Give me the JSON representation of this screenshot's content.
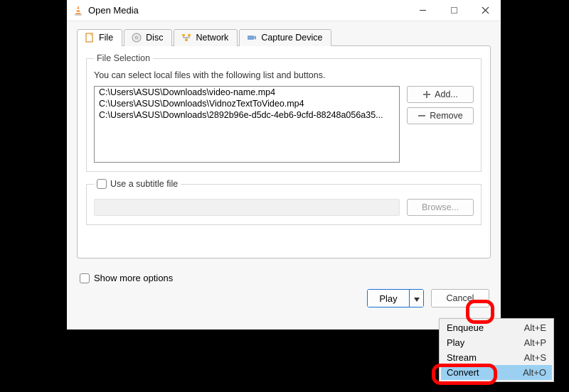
{
  "window": {
    "title": "Open Media"
  },
  "tabs": {
    "file": "File",
    "disc": "Disc",
    "network": "Network",
    "capture": "Capture Device"
  },
  "file_selection": {
    "legend": "File Selection",
    "instruction": "You can select local files with the following list and buttons.",
    "files": [
      "C:\\Users\\ASUS\\Downloads\\video-name.mp4",
      "C:\\Users\\ASUS\\Downloads\\VidnozTextToVideo.mp4",
      "C:\\Users\\ASUS\\Downloads\\2892b96e-d5dc-4eb6-9cfd-88248a056a35..."
    ],
    "add_label": "Add...",
    "remove_label": "Remove"
  },
  "subtitle": {
    "checkbox_label": "Use a subtitle file",
    "browse_label": "Browse..."
  },
  "footer": {
    "show_more_label": "Show more options",
    "play_label": "Play",
    "cancel_label": "Cancel"
  },
  "dropdown": {
    "items": [
      {
        "label": "Enqueue",
        "shortcut": "Alt+E"
      },
      {
        "label": "Play",
        "shortcut": "Alt+P"
      },
      {
        "label": "Stream",
        "shortcut": "Alt+S"
      },
      {
        "label": "Convert",
        "shortcut": "Alt+O"
      }
    ]
  }
}
